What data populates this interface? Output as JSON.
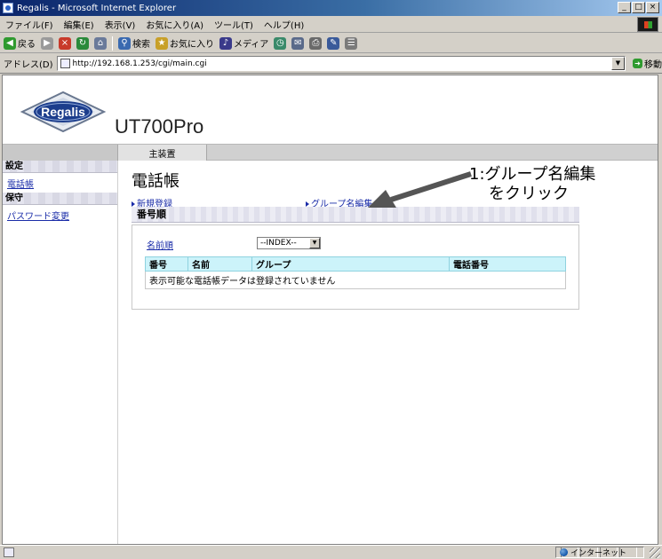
{
  "window": {
    "title": "Regalis - Microsoft Internet Explorer",
    "minimize": "_",
    "maximize": "□",
    "close": "×"
  },
  "menu": {
    "items": [
      "ファイル(F)",
      "編集(E)",
      "表示(V)",
      "お気に入り(A)",
      "ツール(T)",
      "ヘルプ(H)"
    ]
  },
  "toolbar": {
    "back": "戻る",
    "search": "検索",
    "favorites": "お気に入り",
    "media": "メディア"
  },
  "address": {
    "label": "アドレス(D)",
    "url": "http://192.168.1.253/cgi/main.cgi",
    "go": "移動"
  },
  "site": {
    "logo_text": "Regalis",
    "product": "UT700Pro",
    "nav_tab": "主装置"
  },
  "sidebar": {
    "section1": "設定",
    "link1": "電話帳",
    "section2": "保守",
    "link2": "パスワード変更"
  },
  "main": {
    "title": "電話帳",
    "link_new": "新規登録",
    "link_group": "グループ名編集",
    "section_title": "番号順",
    "sort_label": "名前順",
    "index_value": "--INDEX--",
    "columns": [
      "番号",
      "名前",
      "グループ",
      "電話番号"
    ],
    "empty_message": "表示可能な電話帳データは登録されていません"
  },
  "annotation": {
    "line1": "1:グループ名編集",
    "line2": "をクリック"
  },
  "status": {
    "zone": "インターネット"
  }
}
